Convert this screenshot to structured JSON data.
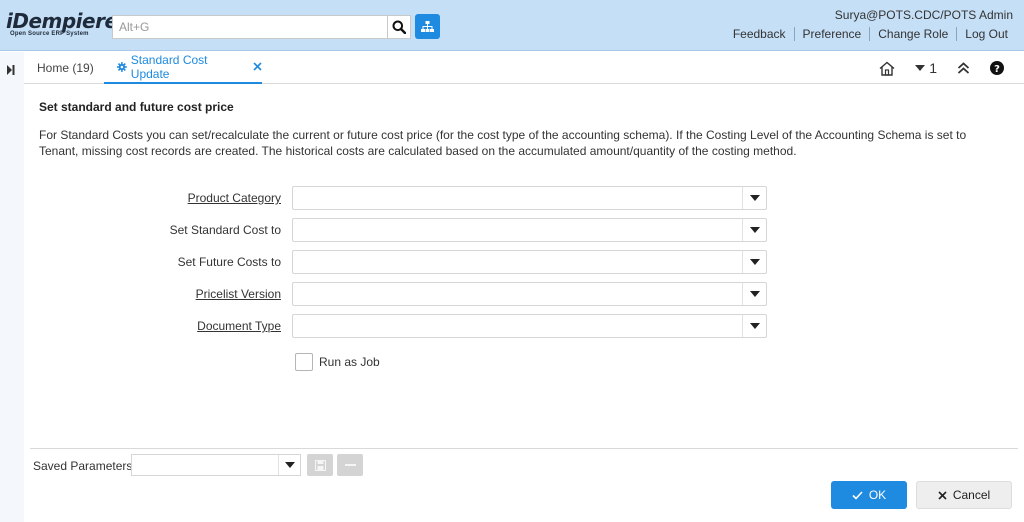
{
  "header": {
    "logo_text": "iDempiere",
    "logo_tagline": "Open Source ERP System",
    "search_placeholder": "Alt+G",
    "user": "Surya@POTS.CDC/POTS Admin",
    "links": [
      "Feedback",
      "Preference",
      "Change Role",
      "Log Out"
    ]
  },
  "tabs": {
    "home": "Home (19)",
    "active": "Standard Cost Update",
    "window_count": "1"
  },
  "process": {
    "title": "Set standard and future cost price",
    "description": "For Standard Costs you can set/recalculate the current or future cost price (for the cost type of the accounting schema). If the Costing Level of the Accounting Schema is set to Tenant, missing cost records are created. The historical costs are calculated based on the accumulated amount/quantity of the costing method."
  },
  "params": [
    {
      "label": "Product Category",
      "value": ""
    },
    {
      "label": "Set Standard Cost to",
      "value": ""
    },
    {
      "label": "Set Future Costs to",
      "value": ""
    },
    {
      "label": "Pricelist Version",
      "value": ""
    },
    {
      "label": "Document Type",
      "value": ""
    }
  ],
  "run_as_job": {
    "label": "Run as Job",
    "checked": false
  },
  "footer": {
    "saved_label": "Saved Parameters",
    "saved_value": "",
    "ok_label": "OK",
    "cancel_label": "Cancel"
  },
  "colors": {
    "header_bg": "#c5dff7",
    "accent": "#1e8ae0"
  }
}
